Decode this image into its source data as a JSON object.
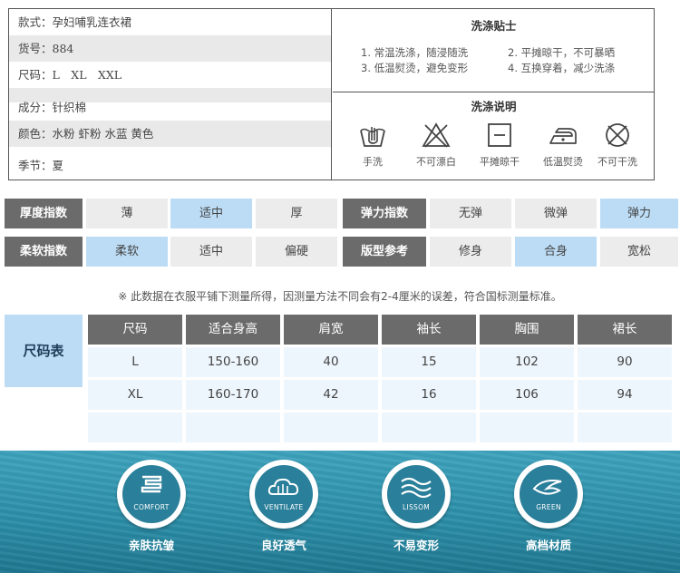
{
  "info": {
    "style": "款式：孕妇哺乳连衣裙",
    "item_no": "货号：884",
    "sizes": "尺码：L　XL　XXL",
    "material": "成分：针织棉",
    "colors": "颜色：水粉 虾粉 水蓝 黄色",
    "season": "季节：夏"
  },
  "wash_tips": {
    "title": "洗涤贴士",
    "tip1": "1. 常温洗涤，随浸随洗",
    "tip2": "2. 平摊晾干，不可暴晒",
    "tip3": "3. 低温熨烫，避免变形",
    "tip4": "4. 互换穿着，减少洗涤"
  },
  "wash_instructions": {
    "title": "洗涤说明",
    "icons": [
      {
        "icon": "hand-wash-icon",
        "label": "手洗"
      },
      {
        "icon": "no-bleach-icon",
        "label": "不可漂白"
      },
      {
        "icon": "flat-dry-icon",
        "label": "平摊晾干"
      },
      {
        "icon": "low-iron-icon",
        "label": "低温熨烫"
      },
      {
        "icon": "no-dry-clean-icon",
        "label": "不可干洗"
      }
    ]
  },
  "grades": {
    "thickness": {
      "label": "厚度指数",
      "options": [
        "薄",
        "适中",
        "厚"
      ],
      "selected": "适中"
    },
    "elasticity": {
      "label": "弹力指数",
      "options": [
        "无弹",
        "微弹",
        "弹力"
      ],
      "selected": "弹力"
    },
    "softness": {
      "label": "柔软指数",
      "options": [
        "柔软",
        "适中",
        "偏硬"
      ],
      "selected": "柔软"
    },
    "fit": {
      "label": "版型参考",
      "options": [
        "修身",
        "合身",
        "宽松"
      ],
      "selected": "合身"
    }
  },
  "note": "※ 此数据在衣服平铺下测量所得，因测量方法不同会有2-4厘米的误差，符合国标测量标准。",
  "size_table": {
    "label": "尺码表",
    "headers": [
      "尺码",
      "适合身高",
      "肩宽",
      "袖长",
      "胸围",
      "裙长"
    ],
    "rows": [
      [
        "L",
        "150-160",
        "40",
        "15",
        "102",
        "90"
      ],
      [
        "XL",
        "160-170",
        "42",
        "16",
        "106",
        "94"
      ],
      [
        "",
        "",
        "",
        "",
        "",
        ""
      ]
    ]
  },
  "features": [
    {
      "icon": "comfort-icon",
      "caption": "COMFORT",
      "name": "亲肤抗皱"
    },
    {
      "icon": "ventilate-icon",
      "caption": "VENTILATE",
      "name": "良好透气"
    },
    {
      "icon": "lissom-icon",
      "caption": "LISSOM",
      "name": "不易变形"
    },
    {
      "icon": "green-icon",
      "caption": "GREEN",
      "name": "高档材质"
    }
  ],
  "colors": {
    "selected": "#bcdcf5",
    "label_bg": "#6b6b6b",
    "band": "#2c8fa9"
  }
}
